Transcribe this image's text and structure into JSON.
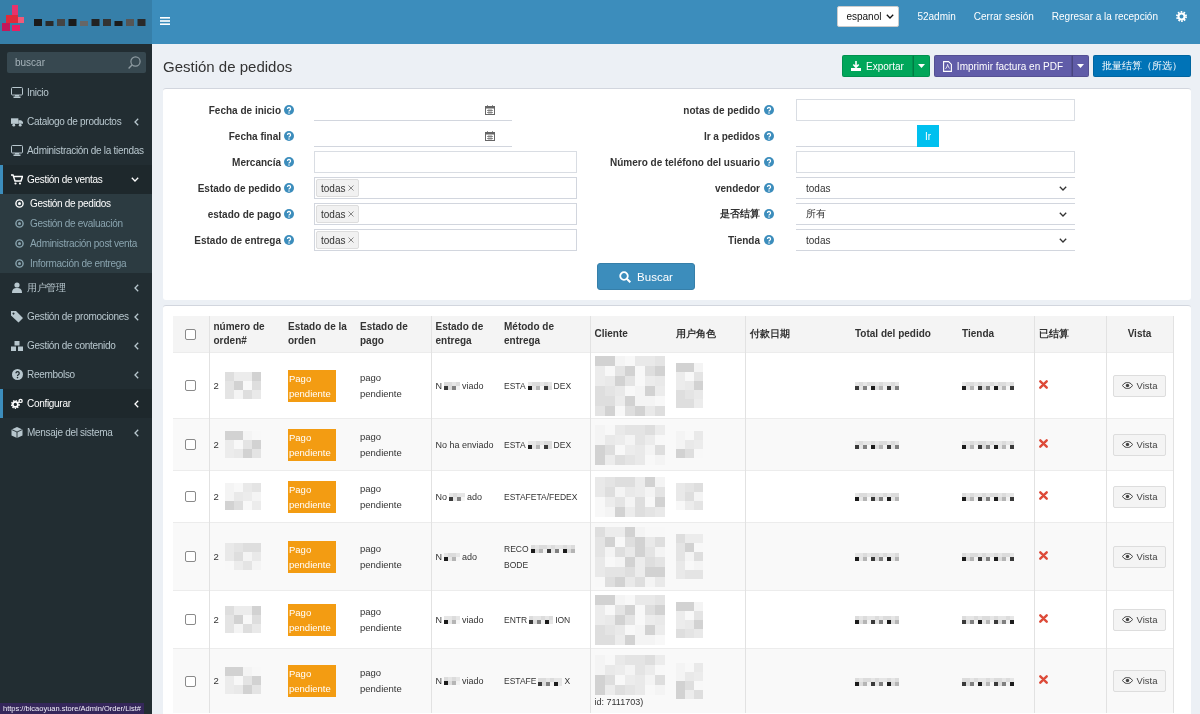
{
  "topbar": {
    "language": "espanol",
    "links": [
      "52admin",
      "Cerrar sesión",
      "Regresar a la recepción"
    ]
  },
  "sidebar": {
    "search": {
      "placeholder": "buscar"
    },
    "items": [
      {
        "label": "Inicio",
        "selected": false
      },
      {
        "label": "Catalogo de productos",
        "selected": false,
        "expanded": false
      },
      {
        "label": "Administración de la tiendas",
        "selected": false
      },
      {
        "label": "Gestión de ventas",
        "selected": true,
        "expanded": true,
        "children": [
          {
            "label": "Gestión de pedidos",
            "selected": true
          },
          {
            "label": "Gestión de evaluación",
            "selected": false
          },
          {
            "label": "Administración post venta",
            "selected": false
          },
          {
            "label": "Información de entrega",
            "selected": false
          }
        ]
      },
      {
        "label": "用户管理",
        "selected": false,
        "expanded": false
      },
      {
        "label": "Gestión de promociones",
        "selected": false,
        "expanded": false
      },
      {
        "label": "Gestión de contenido",
        "selected": false,
        "expanded": false
      },
      {
        "label": "Reembolso",
        "selected": false,
        "expanded": false
      },
      {
        "label": "Configurar",
        "selected": true,
        "expanded": false
      },
      {
        "label": "Mensaje del sistema",
        "selected": false,
        "expanded": false
      }
    ]
  },
  "page": {
    "title": "Gestión de pedidos",
    "buttons": [
      {
        "label": "Exportar",
        "kind": "export",
        "split": true
      },
      {
        "label": "Imprimir factura en PDF",
        "kind": "pdf",
        "split": true
      },
      {
        "label": "批量结算（所选）",
        "kind": "batch",
        "split": false
      }
    ]
  },
  "filters": {
    "left": [
      {
        "label": "Fecha de inicio",
        "kind": "date"
      },
      {
        "label": "Fecha final",
        "kind": "date"
      },
      {
        "label": "Mercancía",
        "kind": "text"
      },
      {
        "label": "Estado de pedido",
        "kind": "tags",
        "tags": [
          "todas"
        ]
      },
      {
        "label": "estado de pago",
        "kind": "tags",
        "tags": [
          "todas"
        ]
      },
      {
        "label": "Estado de entrega",
        "kind": "tags",
        "tags": [
          "todas"
        ]
      }
    ],
    "right": [
      {
        "label": "notas de pedido",
        "kind": "text"
      },
      {
        "label": "Ir a pedidos",
        "kind": "go",
        "button": "Ir"
      },
      {
        "label": "Número de teléfono del usuario",
        "kind": "text"
      },
      {
        "label": "vendedor",
        "kind": "select",
        "value": "todas"
      },
      {
        "label": "是否结算",
        "kind": "select",
        "value": "所有"
      },
      {
        "label": "Tienda",
        "kind": "select",
        "value": "todas"
      }
    ],
    "search_button": "Buscar"
  },
  "table": {
    "header_checkbox": {
      "checked": false
    },
    "columns": [
      "número de orden#",
      "Estado de la orden",
      "Estado de pago",
      "Estado de entrega",
      "Método de entrega",
      "Cliente",
      "用户角色",
      "付款日期",
      "Total del pedido",
      "Tienda",
      "已结算",
      "Vista"
    ],
    "rows": [
      {
        "checked": false,
        "order_number": "2",
        "order_status": "Pago pendiente",
        "payment_status": "pago pendiente",
        "delivery_status": [
          "N",
          "viado"
        ],
        "delivery_method": [
          "ESTA",
          "DEX"
        ],
        "settled": false,
        "action": "Vista"
      },
      {
        "checked": false,
        "order_number": "2",
        "order_status": "Pago pendiente",
        "payment_status": "pago pendiente",
        "delivery_status": [
          "No ha enviado"
        ],
        "delivery_method": [
          "ESTA",
          "DEX"
        ],
        "settled": false,
        "action": "Vista"
      },
      {
        "checked": false,
        "order_number": "2",
        "order_status": "Pago pendiente",
        "payment_status": "pago pendiente",
        "delivery_status": [
          "No",
          "ado"
        ],
        "delivery_method": [
          "ESTAFETA/FEDEX"
        ],
        "settled": false,
        "action": "Vista"
      },
      {
        "checked": false,
        "order_number": "2",
        "order_status": "Pago pendiente",
        "payment_status": "pago pendiente",
        "delivery_status": [
          "N",
          "ado"
        ],
        "delivery_method": [
          "RECO",
          "BODE"
        ],
        "settled": false,
        "action": "Vista"
      },
      {
        "checked": false,
        "order_number": "2",
        "order_status": "Pago pendiente",
        "payment_status": "pago pendiente",
        "delivery_status": [
          "N",
          "viado"
        ],
        "delivery_method": [
          "ENTR",
          "ION"
        ],
        "settled": false,
        "action": "Vista"
      },
      {
        "checked": false,
        "order_number": "2",
        "order_status": "Pago pendiente",
        "payment_status": "pago pendiente",
        "delivery_status": [
          "N",
          "viado"
        ],
        "delivery_method": [
          "ESTAFE",
          "X"
        ],
        "client_note": "id: 7111703)",
        "settled": false,
        "action": "Vista"
      }
    ]
  },
  "status_url": "https://bicaoyuan.store/Admin/Order/List#"
}
